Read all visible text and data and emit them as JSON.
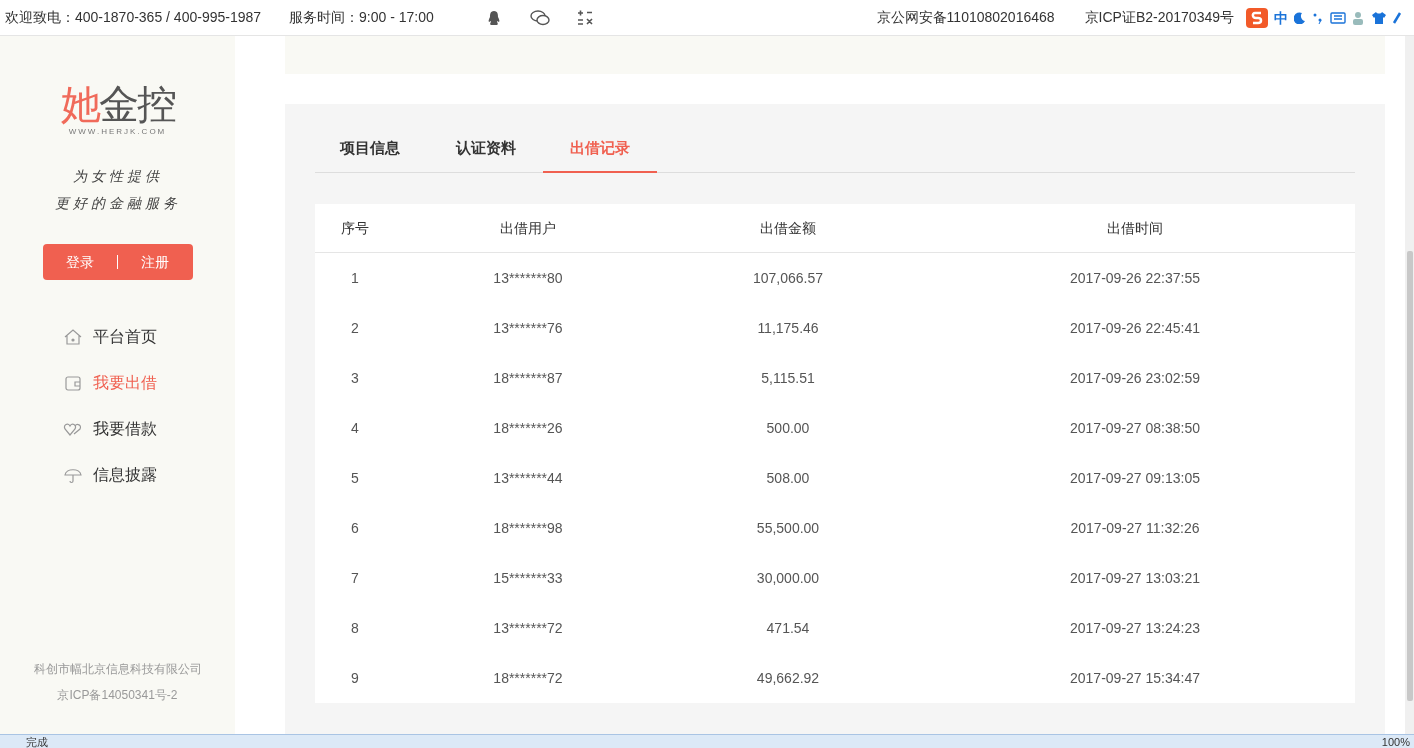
{
  "top_bar": {
    "hotline": "欢迎致电：400-1870-365 / 400-995-1987",
    "service_hours": "服务时间：9:00 - 17:00",
    "police_record": "京公网安备11010802016468",
    "icp": "京ICP证B2-20170349号"
  },
  "ime_toolbar": {
    "mode": "中"
  },
  "sidebar": {
    "logo": {
      "first": "她",
      "rest": "金控",
      "url": "WWW.HERJK.COM"
    },
    "slogan": [
      "为女性提供",
      "更好的金融服务"
    ],
    "login": "登录",
    "register": "注册",
    "items": [
      {
        "label": "平台首页",
        "kind": "house",
        "selected": false
      },
      {
        "label": "我要出借",
        "kind": "wallet",
        "selected": true
      },
      {
        "label": "我要借款",
        "kind": "hearts",
        "selected": false
      },
      {
        "label": "信息披露",
        "kind": "umbrella",
        "selected": false
      }
    ],
    "footer": [
      "科创市幅北京信息科技有限公司",
      "京ICP备14050341号-2"
    ]
  },
  "tabs": [
    {
      "label": "项目信息",
      "selected": false
    },
    {
      "label": "认证资料",
      "selected": false
    },
    {
      "label": "出借记录",
      "selected": true
    }
  ],
  "table": {
    "columns": [
      "序号",
      "出借用户",
      "出借金额",
      "出借时间"
    ],
    "rows": [
      [
        "1",
        "13*******80",
        "107,066.57",
        "2017-09-26 22:37:55"
      ],
      [
        "2",
        "13*******76",
        "11,175.46",
        "2017-09-26 22:45:41"
      ],
      [
        "3",
        "18*******87",
        "5,115.51",
        "2017-09-26 23:02:59"
      ],
      [
        "4",
        "18*******26",
        "500.00",
        "2017-09-27 08:38:50"
      ],
      [
        "5",
        "13*******44",
        "508.00",
        "2017-09-27 09:13:05"
      ],
      [
        "6",
        "18*******98",
        "55,500.00",
        "2017-09-27 11:32:26"
      ],
      [
        "7",
        "15*******33",
        "30,000.00",
        "2017-09-27 13:03:21"
      ],
      [
        "8",
        "13*******72",
        "471.54",
        "2017-09-27 13:24:23"
      ],
      [
        "9",
        "18*******72",
        "49,662.92",
        "2017-09-27 15:34:47"
      ]
    ]
  },
  "status_bar": {
    "text": "完成",
    "zoom": "100%"
  }
}
